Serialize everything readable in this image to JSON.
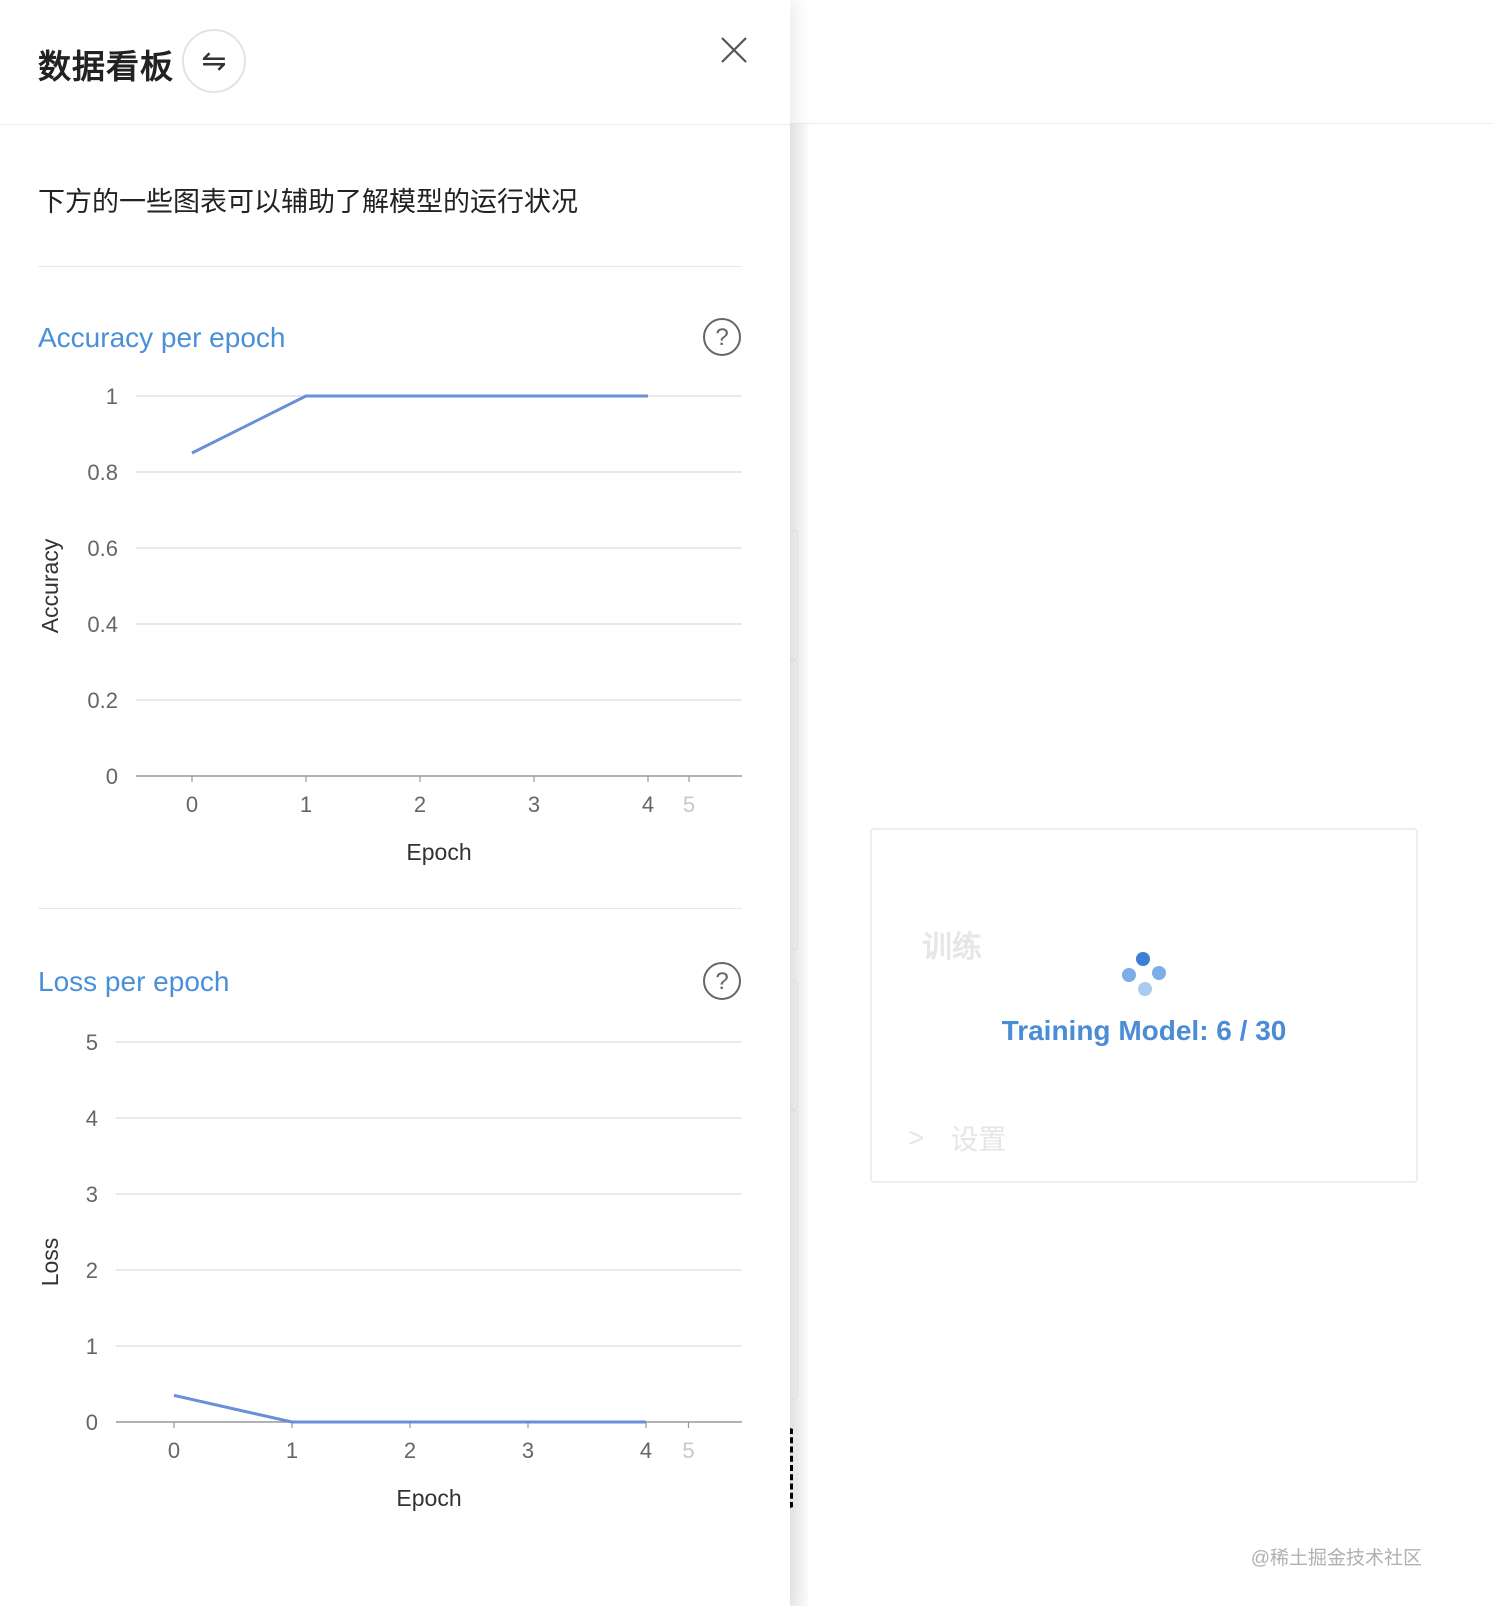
{
  "drawer": {
    "title": "数据看板",
    "swap_icon": "⇋",
    "description": "下方的一些图表可以辅助了解模型的运行状况"
  },
  "charts": {
    "accuracy": {
      "title": "Accuracy per epoch"
    },
    "loss": {
      "title": "Loss per epoch"
    }
  },
  "background": {
    "section_title": "训练",
    "training_status": "Training Model: 6 / 30",
    "settings_label": "设置",
    "settings_chevron": ">",
    "watermark": "@稀土掘金技术社区"
  },
  "colors": {
    "line": "#6a8fd8",
    "accent": "#4a90d9",
    "grid": "#dcdcdc"
  },
  "chart_data": [
    {
      "type": "line",
      "title": "Accuracy per epoch",
      "xlabel": "Epoch",
      "ylabel": "Accuracy",
      "x": [
        0,
        1,
        2,
        3,
        4
      ],
      "values": [
        0.85,
        1,
        1,
        1,
        1
      ],
      "xlim": [
        0,
        5
      ],
      "ylim": [
        0,
        1
      ],
      "xticks": [
        "0",
        "1",
        "2",
        "3",
        "4",
        "5"
      ],
      "yticks": [
        "0",
        "0.2",
        "0.4",
        "0.6",
        "0.8",
        "1"
      ],
      "grid": true
    },
    {
      "type": "line",
      "title": "Loss per epoch",
      "xlabel": "Epoch",
      "ylabel": "Loss",
      "x": [
        0,
        1,
        2,
        3,
        4
      ],
      "values": [
        0.35,
        0,
        0,
        0,
        0
      ],
      "xlim": [
        0,
        5
      ],
      "ylim": [
        0,
        5
      ],
      "xticks": [
        "0",
        "1",
        "2",
        "3",
        "4",
        "5"
      ],
      "yticks": [
        "0",
        "1",
        "2",
        "3",
        "4",
        "5"
      ],
      "grid": true
    }
  ]
}
